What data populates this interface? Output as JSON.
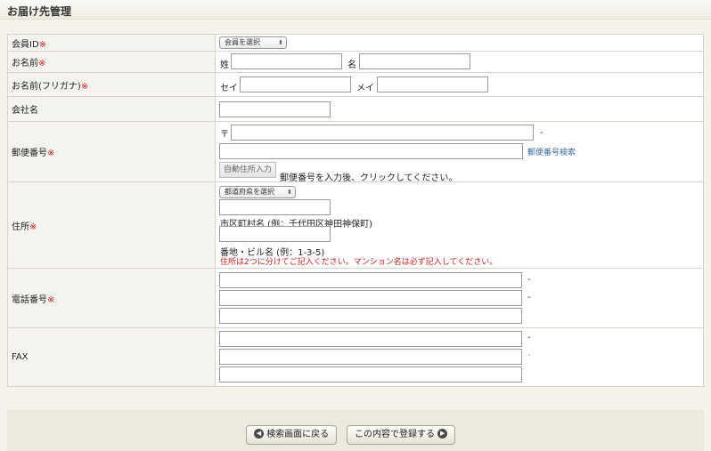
{
  "page": {
    "title": "お届け先管理"
  },
  "rows": {
    "member_id": {
      "label": "会員ID",
      "required_mark": "※",
      "select_value": "会員を選択"
    },
    "name": {
      "label": "お名前",
      "required_mark": "※",
      "last_label": "姓",
      "first_label": "名"
    },
    "name_kana": {
      "label": "お名前(フリガナ)",
      "required_mark": "※",
      "last_label": "セイ",
      "first_label": "メイ"
    },
    "company": {
      "label": "会社名"
    },
    "postal": {
      "label": "郵便番号",
      "required_mark": "※",
      "prefix": "〒",
      "dash": "-",
      "lookup_link": "郵便番号検索",
      "autofill_button": "自動住所入力",
      "autofill_hint": "郵便番号を入力後、クリックしてください。"
    },
    "address": {
      "label": "住所",
      "required_mark": "※",
      "pref_select": "都道府県を選択",
      "city_caption": "市区町村名 (例：千代田区神田神保町)",
      "street_caption": "番地・ビル名 (例：1-3-5)",
      "note": "住所は2つに分けてご記入ください。マンション名は必ず記入してください。"
    },
    "phone": {
      "label": "電話番号",
      "required_mark": "※",
      "dash": "-"
    },
    "fax": {
      "label": "FAX",
      "dash": "-"
    }
  },
  "footer": {
    "back_button": "検索画面に戻る",
    "submit_button": "この内容で登録する",
    "back_icon": "left-arrow-circle-icon",
    "submit_icon": "right-arrow-circle-icon"
  },
  "colors": {
    "required": "#d01e1e",
    "link": "#3a6aa0",
    "label_bg": "#f4f3ef",
    "page_bg": "#f5f2e9"
  }
}
